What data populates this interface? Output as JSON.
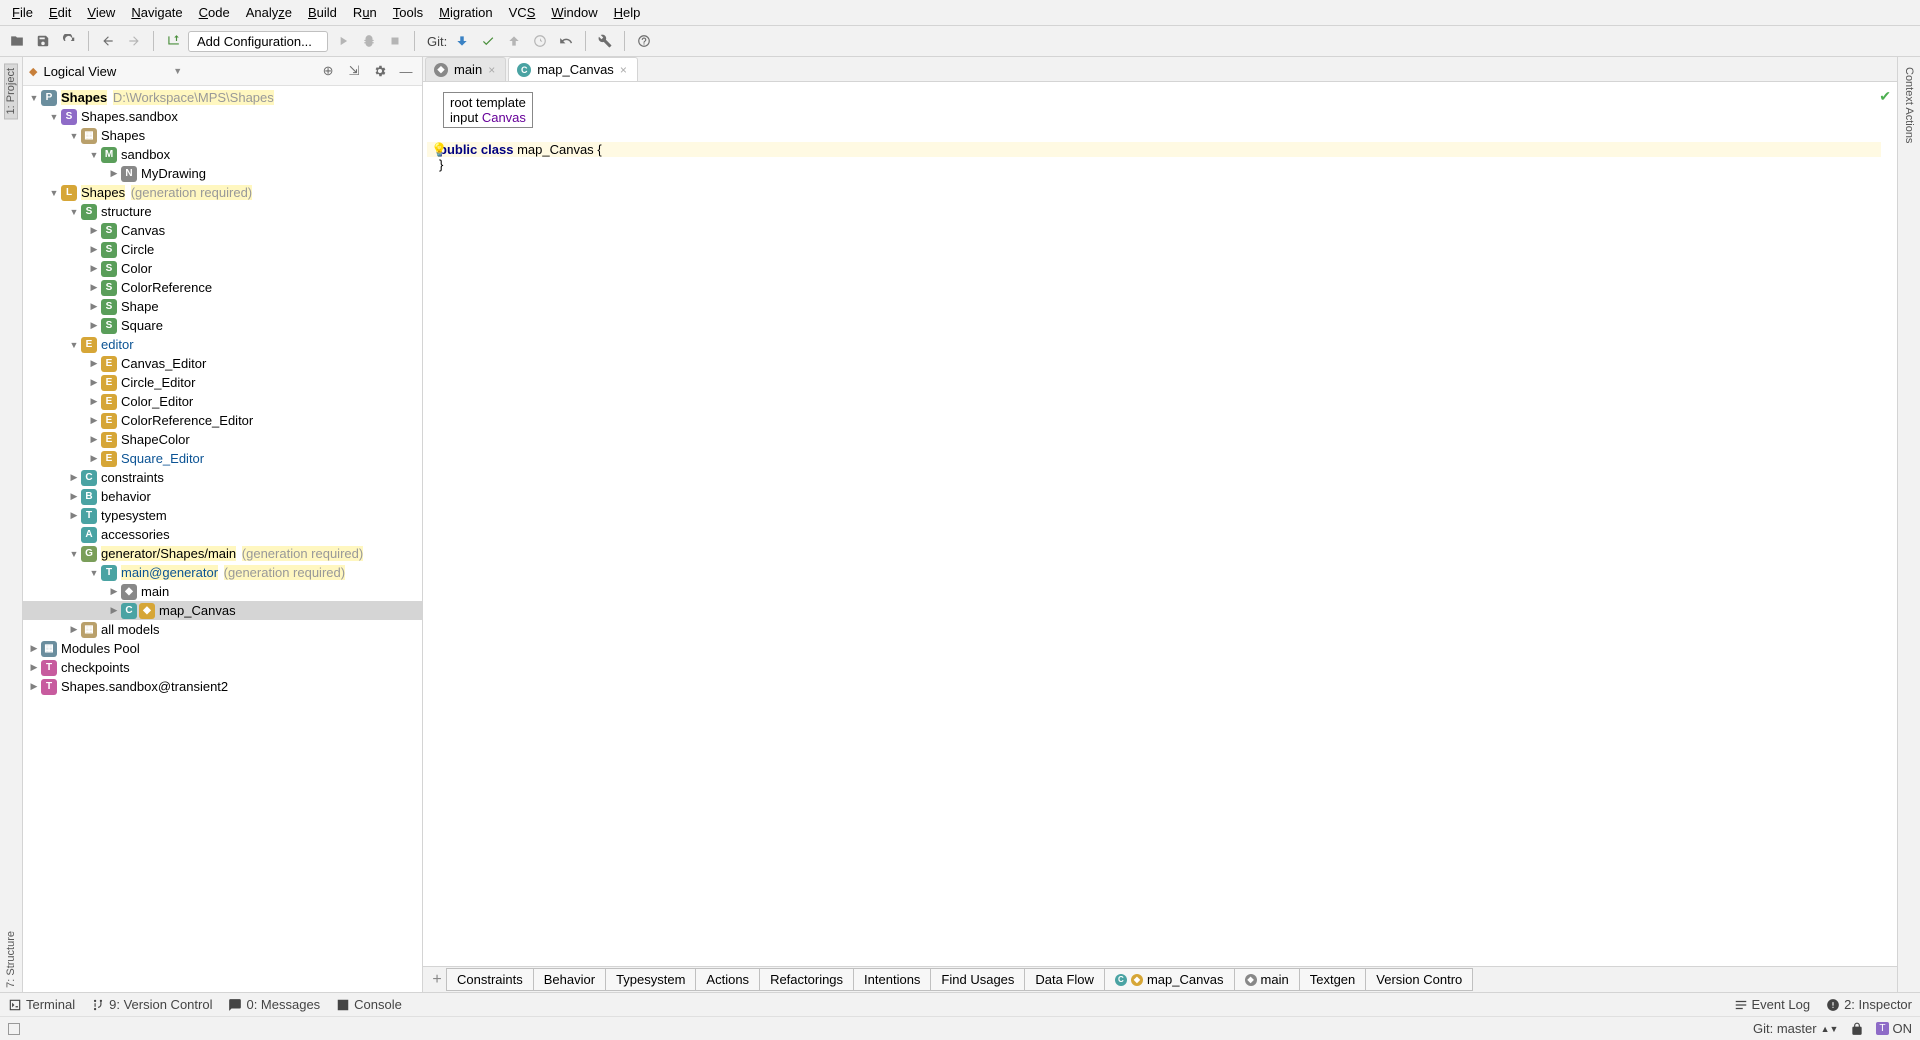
{
  "menu": [
    "File",
    "Edit",
    "View",
    "Navigate",
    "Code",
    "Analyze",
    "Build",
    "Run",
    "Tools",
    "Migration",
    "VCS",
    "Window",
    "Help"
  ],
  "menu_ul": [
    "F",
    "E",
    "V",
    "N",
    "C",
    "A",
    "B",
    "R",
    "T",
    "M",
    "S",
    "W",
    "H"
  ],
  "toolbar": {
    "git_label": "Git:",
    "config": "Add Configuration..."
  },
  "sidebar": {
    "title": "Logical View",
    "project_label": "1: Project"
  },
  "tree": {
    "shapes": "Shapes",
    "shapes_path": "D:\\Workspace\\MPS\\Shapes",
    "sandbox_module": "Shapes.sandbox",
    "sandbox_folder": "Shapes",
    "sandbox_model": "sandbox",
    "mydrawing": "MyDrawing",
    "lang_module": "Shapes",
    "gen_required": "(generation required)",
    "structure": "structure",
    "canvas": "Canvas",
    "circle": "Circle",
    "color": "Color",
    "colorref": "ColorReference",
    "shape": "Shape",
    "square": "Square",
    "editor": "editor",
    "canvas_ed": "Canvas_Editor",
    "circle_ed": "Circle_Editor",
    "color_ed": "Color_Editor",
    "colorref_ed": "ColorReference_Editor",
    "shapecolor": "ShapeColor",
    "square_ed": "Square_Editor",
    "constraints": "constraints",
    "behavior": "behavior",
    "typesystem": "typesystem",
    "accessories": "accessories",
    "generator": "generator/Shapes/main",
    "main_at_gen": "main@generator",
    "main": "main",
    "map_canvas": "map_Canvas",
    "all_models": "all models",
    "modules_pool": "Modules Pool",
    "checkpoints": "checkpoints",
    "transient": "Shapes.sandbox@transient2"
  },
  "tabs": {
    "main": "main",
    "map_canvas": "map_Canvas"
  },
  "code": {
    "root_template": "root template",
    "input": "input",
    "canvas": "Canvas",
    "public": "public",
    "class": "class",
    "name": "map_Canvas",
    "brace_open": "{",
    "brace_close": "}"
  },
  "bottom_tabs": [
    "Constraints",
    "Behavior",
    "Typesystem",
    "Actions",
    "Refactorings",
    "Intentions",
    "Find Usages",
    "Data Flow"
  ],
  "bottom_special": {
    "map_canvas": "map_Canvas",
    "main": "main",
    "textgen": "Textgen",
    "version": "Version Contro"
  },
  "status": {
    "terminal": "Terminal",
    "vcs": "9: Version Control",
    "messages": "0: Messages",
    "console": "Console",
    "eventlog": "Event Log",
    "inspector": "2: Inspector"
  },
  "footer": {
    "git": "Git: master",
    "on": "ON"
  },
  "right_rail": "Context Actions",
  "left_rail_structure": "7: Structure"
}
